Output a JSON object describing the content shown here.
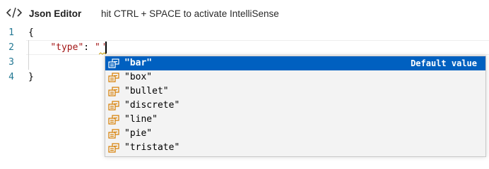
{
  "header": {
    "title": "Json Editor",
    "hint": "hit CTRL + SPACE to activate IntelliSense",
    "icon": "code-icon"
  },
  "editor": {
    "line_numbers": [
      "1",
      "2",
      "3",
      "4"
    ],
    "lines": {
      "l1": "{",
      "l2_key": "\"type\"",
      "l2_colon": ": ",
      "l2_value": "\"",
      "l2_value_close": "\"",
      "l3": "",
      "l4": "}"
    }
  },
  "suggest": {
    "items": [
      {
        "label": "\"bar\"",
        "detail": "Default value",
        "icon": "enum-member-icon",
        "selected": true
      },
      {
        "label": "\"box\"",
        "detail": "",
        "icon": "enum-member-icon"
      },
      {
        "label": "\"bullet\"",
        "detail": "",
        "icon": "enum-member-icon"
      },
      {
        "label": "\"discrete\"",
        "detail": "",
        "icon": "enum-member-icon"
      },
      {
        "label": "\"line\"",
        "detail": "",
        "icon": "enum-member-icon"
      },
      {
        "label": "\"pie\"",
        "detail": "",
        "icon": "enum-member-icon"
      },
      {
        "label": "\"tristate\"",
        "detail": "",
        "icon": "enum-member-icon"
      }
    ]
  },
  "colors": {
    "selection": "#0060c0",
    "line_number": "#237893",
    "string": "#a31515",
    "icon_orange": "#d67e00"
  }
}
